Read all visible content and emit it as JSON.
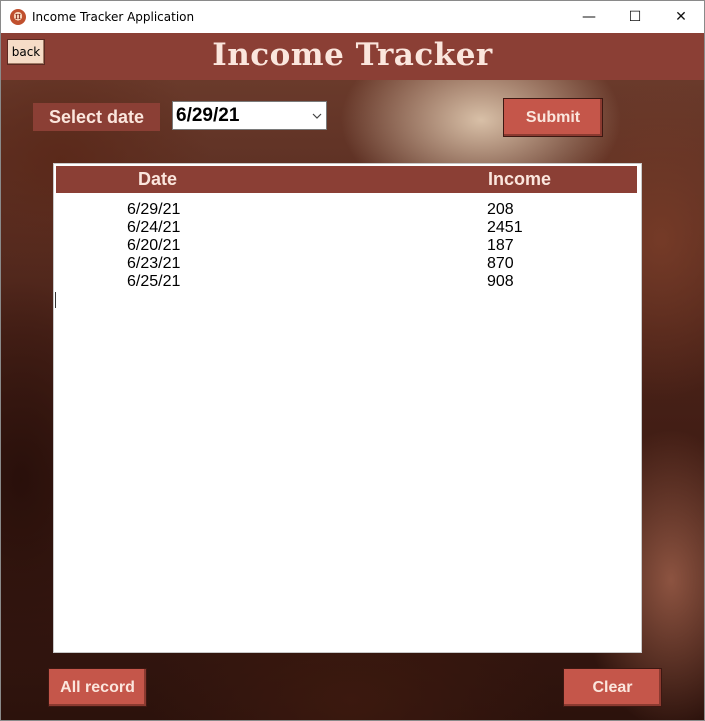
{
  "window": {
    "title": "Income Tracker Application",
    "controls": {
      "minimize": "—",
      "maximize": "☐",
      "close": "✕"
    }
  },
  "header": {
    "title": "Income Tracker",
    "back_label": "back"
  },
  "filter": {
    "label": "Select date",
    "selected_date": "6/29/21",
    "submit_label": "Submit"
  },
  "table": {
    "columns": [
      "Date",
      "Income"
    ],
    "rows": [
      {
        "date": "6/29/21",
        "income": "208"
      },
      {
        "date": "6/24/21",
        "income": "2451"
      },
      {
        "date": "6/20/21",
        "income": "187"
      },
      {
        "date": "6/23/21",
        "income": "870"
      },
      {
        "date": "6/25/21",
        "income": "908"
      }
    ]
  },
  "footer": {
    "all_record_label": "All record",
    "clear_label": "Clear"
  },
  "colors": {
    "brand": "#8b3f35",
    "button": "#c5564a",
    "header_text": "#fbe6dd",
    "back_button": "#f6dcc7"
  }
}
